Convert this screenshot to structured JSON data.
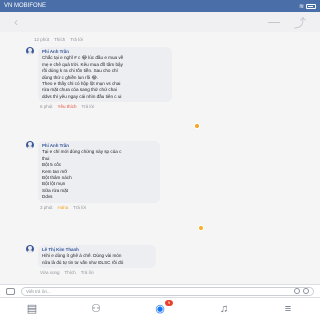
{
  "status_bar": {
    "carrier": "VN MOBIFONE",
    "wifi_icon": "wifi-icon",
    "time": "",
    "battery_icon": "battery-icon"
  },
  "thread": {
    "comments": [
      {
        "meta": [
          "12 phút",
          "Thích",
          "Trả lời"
        ]
      },
      {
        "author": "Phi Anh Trần",
        "lines": [
          "Chắc tại e nghĩ # c 😂 lúc đầu e mua về",
          "mẹ e chê quá trời. Kêu mua đồ tầm bậy",
          "rồi dùng k ra chi tốn tiền. Sau cho chỉ",
          "dùng thử c ghiền lun rồi 😂.",
          "Theo e thấy chỉ có hộp lột mụn vs chai",
          "rửa mặt chưa cóa sang thử chứ chai",
          "ddvs thì yêu ngay cái nhìn đầu tiên c ui"
        ],
        "meta": [
          "6 phút",
          "Yêu thích",
          "Trả lời"
        ]
      },
      {
        "author": "Phi Anh Trần",
        "lines": [
          "Tại e chỉ mới dùng chừng này sp của c",
          "thui",
          "Bột 5 cốc",
          "Kem tan mỡ",
          "Bột thâm nách",
          "Bột lột mụn",
          "Sữa rửa mặt",
          "Ddvs"
        ],
        "meta": [
          "3 phút",
          "Haha",
          "Trả lời"
        ]
      },
      {
        "author": "Lê Thị Kim Thanh",
        "lines": [
          "Hihi e dùng ít ghê à chế. Dùng vài món",
          "nữa là đủ tự tin tư vấn như ĐLSC rồi đó"
        ],
        "meta": [
          "Vừa xong",
          "Thích",
          "Trả lời"
        ]
      }
    ]
  },
  "input": {
    "placeholder": "Viết trả lời...",
    "camera_icon": "camera-icon",
    "gif_icon": "gif-icon",
    "emoji_icon": "emoji-icon"
  },
  "bottom_nav": {
    "items": [
      {
        "icon": "news-feed-icon"
      },
      {
        "icon": "friends-icon"
      },
      {
        "icon": "messenger-icon",
        "badge": "9"
      },
      {
        "icon": "notifications-icon"
      },
      {
        "icon": "menu-icon"
      }
    ]
  }
}
